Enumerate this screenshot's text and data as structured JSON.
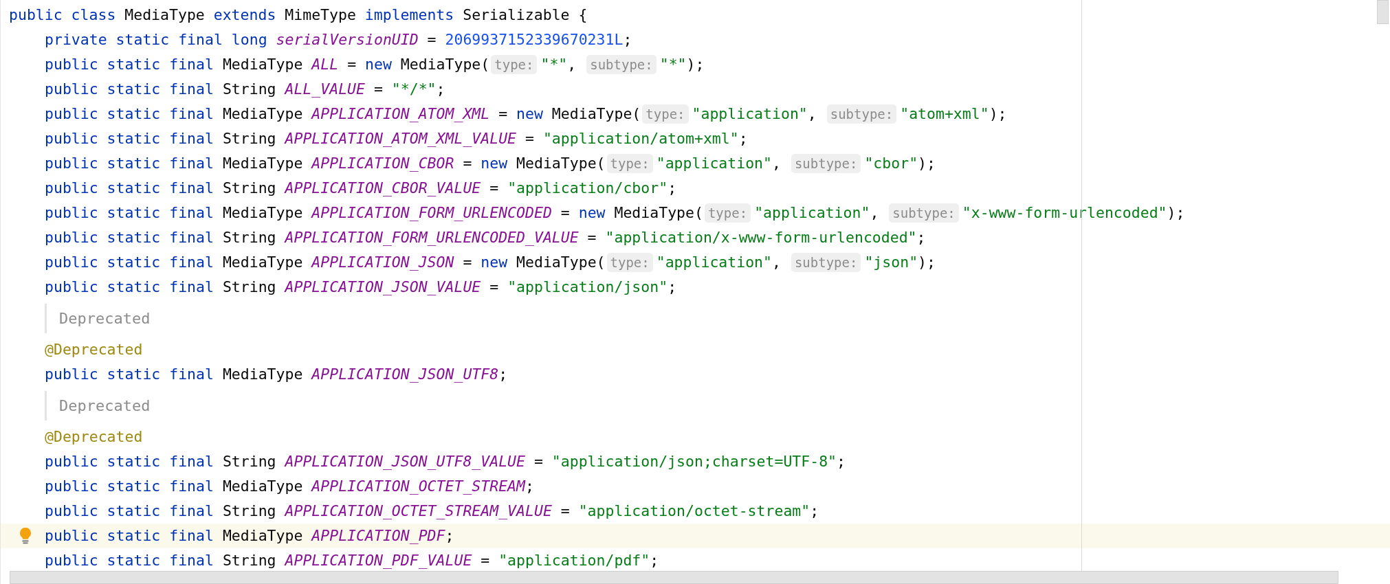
{
  "class_line": {
    "tokens": [
      {
        "kind": "keyword",
        "text": "public class "
      },
      {
        "kind": "plain",
        "text": "MediaType "
      },
      {
        "kind": "keyword",
        "text": "extends "
      },
      {
        "kind": "plain",
        "text": "MimeType "
      },
      {
        "kind": "keyword",
        "text": "implements "
      },
      {
        "kind": "plain",
        "text": "Serializable {"
      }
    ]
  },
  "body": [
    {
      "kind": "code",
      "highlighted": false,
      "tokens": [
        {
          "kind": "keyword",
          "text": "private static final long "
        },
        {
          "kind": "field",
          "text": "serialVersionUID"
        },
        {
          "kind": "plain",
          "text": " = "
        },
        {
          "kind": "number",
          "text": "2069937152339670231L"
        },
        {
          "kind": "plain",
          "text": ";"
        }
      ]
    },
    {
      "kind": "code",
      "highlighted": false,
      "tokens": [
        {
          "kind": "keyword",
          "text": "public static final "
        },
        {
          "kind": "plain",
          "text": "MediaType "
        },
        {
          "kind": "field",
          "text": "ALL"
        },
        {
          "kind": "plain",
          "text": " = "
        },
        {
          "kind": "keyword",
          "text": "new "
        },
        {
          "kind": "plain",
          "text": "MediaType("
        },
        {
          "kind": "hint",
          "text": "type:"
        },
        {
          "kind": "string",
          "text": "\"*\""
        },
        {
          "kind": "plain",
          "text": ", "
        },
        {
          "kind": "hint",
          "text": "subtype:"
        },
        {
          "kind": "string",
          "text": "\"*\""
        },
        {
          "kind": "plain",
          "text": ");"
        }
      ]
    },
    {
      "kind": "code",
      "highlighted": false,
      "tokens": [
        {
          "kind": "keyword",
          "text": "public static final "
        },
        {
          "kind": "plain",
          "text": "String "
        },
        {
          "kind": "field",
          "text": "ALL_VALUE"
        },
        {
          "kind": "plain",
          "text": " = "
        },
        {
          "kind": "string",
          "text": "\"*/*\""
        },
        {
          "kind": "plain",
          "text": ";"
        }
      ]
    },
    {
      "kind": "code",
      "highlighted": false,
      "tokens": [
        {
          "kind": "keyword",
          "text": "public static final "
        },
        {
          "kind": "plain",
          "text": "MediaType "
        },
        {
          "kind": "field",
          "text": "APPLICATION_ATOM_XML"
        },
        {
          "kind": "plain",
          "text": " = "
        },
        {
          "kind": "keyword",
          "text": "new "
        },
        {
          "kind": "plain",
          "text": "MediaType("
        },
        {
          "kind": "hint",
          "text": "type:"
        },
        {
          "kind": "string",
          "text": "\"application\""
        },
        {
          "kind": "plain",
          "text": ", "
        },
        {
          "kind": "hint",
          "text": "subtype:"
        },
        {
          "kind": "string",
          "text": "\"atom+xml\""
        },
        {
          "kind": "plain",
          "text": ");"
        }
      ]
    },
    {
      "kind": "code",
      "highlighted": false,
      "tokens": [
        {
          "kind": "keyword",
          "text": "public static final "
        },
        {
          "kind": "plain",
          "text": "String "
        },
        {
          "kind": "field",
          "text": "APPLICATION_ATOM_XML_VALUE"
        },
        {
          "kind": "plain",
          "text": " = "
        },
        {
          "kind": "string",
          "text": "\"application/atom+xml\""
        },
        {
          "kind": "plain",
          "text": ";"
        }
      ]
    },
    {
      "kind": "code",
      "highlighted": false,
      "tokens": [
        {
          "kind": "keyword",
          "text": "public static final "
        },
        {
          "kind": "plain",
          "text": "MediaType "
        },
        {
          "kind": "field",
          "text": "APPLICATION_CBOR"
        },
        {
          "kind": "plain",
          "text": " = "
        },
        {
          "kind": "keyword",
          "text": "new "
        },
        {
          "kind": "plain",
          "text": "MediaType("
        },
        {
          "kind": "hint",
          "text": "type:"
        },
        {
          "kind": "string",
          "text": "\"application\""
        },
        {
          "kind": "plain",
          "text": ", "
        },
        {
          "kind": "hint",
          "text": "subtype:"
        },
        {
          "kind": "string",
          "text": "\"cbor\""
        },
        {
          "kind": "plain",
          "text": ");"
        }
      ]
    },
    {
      "kind": "code",
      "highlighted": false,
      "tokens": [
        {
          "kind": "keyword",
          "text": "public static final "
        },
        {
          "kind": "plain",
          "text": "String "
        },
        {
          "kind": "field",
          "text": "APPLICATION_CBOR_VALUE"
        },
        {
          "kind": "plain",
          "text": " = "
        },
        {
          "kind": "string",
          "text": "\"application/cbor\""
        },
        {
          "kind": "plain",
          "text": ";"
        }
      ]
    },
    {
      "kind": "code",
      "highlighted": false,
      "tokens": [
        {
          "kind": "keyword",
          "text": "public static final "
        },
        {
          "kind": "plain",
          "text": "MediaType "
        },
        {
          "kind": "field",
          "text": "APPLICATION_FORM_URLENCODED"
        },
        {
          "kind": "plain",
          "text": " = "
        },
        {
          "kind": "keyword",
          "text": "new "
        },
        {
          "kind": "plain",
          "text": "MediaType("
        },
        {
          "kind": "hint",
          "text": "type:"
        },
        {
          "kind": "string",
          "text": "\"application\""
        },
        {
          "kind": "plain",
          "text": ", "
        },
        {
          "kind": "hint",
          "text": "subtype:"
        },
        {
          "kind": "string",
          "text": "\"x-www-form-urlencoded\""
        },
        {
          "kind": "plain",
          "text": ");"
        }
      ]
    },
    {
      "kind": "code",
      "highlighted": false,
      "tokens": [
        {
          "kind": "keyword",
          "text": "public static final "
        },
        {
          "kind": "plain",
          "text": "String "
        },
        {
          "kind": "field",
          "text": "APPLICATION_FORM_URLENCODED_VALUE"
        },
        {
          "kind": "plain",
          "text": " = "
        },
        {
          "kind": "string",
          "text": "\"application/x-www-form-urlencoded\""
        },
        {
          "kind": "plain",
          "text": ";"
        }
      ]
    },
    {
      "kind": "code",
      "highlighted": false,
      "tokens": [
        {
          "kind": "keyword",
          "text": "public static final "
        },
        {
          "kind": "plain",
          "text": "MediaType "
        },
        {
          "kind": "field",
          "text": "APPLICATION_JSON"
        },
        {
          "kind": "plain",
          "text": " = "
        },
        {
          "kind": "keyword",
          "text": "new "
        },
        {
          "kind": "plain",
          "text": "MediaType("
        },
        {
          "kind": "hint",
          "text": "type:"
        },
        {
          "kind": "string",
          "text": "\"application\""
        },
        {
          "kind": "plain",
          "text": ", "
        },
        {
          "kind": "hint",
          "text": "subtype:"
        },
        {
          "kind": "string",
          "text": "\"json\""
        },
        {
          "kind": "plain",
          "text": ");"
        }
      ]
    },
    {
      "kind": "code",
      "highlighted": false,
      "tokens": [
        {
          "kind": "keyword",
          "text": "public static final "
        },
        {
          "kind": "plain",
          "text": "String "
        },
        {
          "kind": "field",
          "text": "APPLICATION_JSON_VALUE"
        },
        {
          "kind": "plain",
          "text": " = "
        },
        {
          "kind": "string",
          "text": "\"application/json\""
        },
        {
          "kind": "plain",
          "text": ";"
        }
      ]
    },
    {
      "kind": "doc",
      "text": "Deprecated"
    },
    {
      "kind": "code",
      "highlighted": false,
      "tokens": [
        {
          "kind": "annotation",
          "text": "@Deprecated"
        }
      ]
    },
    {
      "kind": "code",
      "highlighted": false,
      "tokens": [
        {
          "kind": "keyword",
          "text": "public static final "
        },
        {
          "kind": "plain",
          "text": "MediaType "
        },
        {
          "kind": "field",
          "text": "APPLICATION_JSON_UTF8"
        },
        {
          "kind": "plain",
          "text": ";"
        }
      ]
    },
    {
      "kind": "doc",
      "text": "Deprecated"
    },
    {
      "kind": "code",
      "highlighted": false,
      "tokens": [
        {
          "kind": "annotation",
          "text": "@Deprecated"
        }
      ]
    },
    {
      "kind": "code",
      "highlighted": false,
      "tokens": [
        {
          "kind": "keyword",
          "text": "public static final "
        },
        {
          "kind": "plain",
          "text": "String "
        },
        {
          "kind": "field",
          "text": "APPLICATION_JSON_UTF8_VALUE"
        },
        {
          "kind": "plain",
          "text": " = "
        },
        {
          "kind": "string",
          "text": "\"application/json;charset=UTF-8\""
        },
        {
          "kind": "plain",
          "text": ";"
        }
      ]
    },
    {
      "kind": "code",
      "highlighted": false,
      "tokens": [
        {
          "kind": "keyword",
          "text": "public static final "
        },
        {
          "kind": "plain",
          "text": "MediaType "
        },
        {
          "kind": "field",
          "text": "APPLICATION_OCTET_STREAM"
        },
        {
          "kind": "plain",
          "text": ";"
        }
      ]
    },
    {
      "kind": "code",
      "highlighted": false,
      "tokens": [
        {
          "kind": "keyword",
          "text": "public static final "
        },
        {
          "kind": "plain",
          "text": "String "
        },
        {
          "kind": "field",
          "text": "APPLICATION_OCTET_STREAM_VALUE"
        },
        {
          "kind": "plain",
          "text": " = "
        },
        {
          "kind": "string",
          "text": "\"application/octet-stream\""
        },
        {
          "kind": "plain",
          "text": ";"
        }
      ]
    },
    {
      "kind": "code",
      "highlighted": true,
      "tokens": [
        {
          "kind": "keyword",
          "text": "public static final "
        },
        {
          "kind": "plain",
          "text": "MediaType "
        },
        {
          "kind": "field",
          "text": "APPLICATION_PDF"
        },
        {
          "kind": "plain",
          "text": ";"
        }
      ]
    },
    {
      "kind": "code",
      "highlighted": false,
      "tokens": [
        {
          "kind": "keyword",
          "text": "public static final "
        },
        {
          "kind": "plain",
          "text": "String "
        },
        {
          "kind": "field",
          "text": "APPLICATION_PDF_VALUE"
        },
        {
          "kind": "plain",
          "text": " = "
        },
        {
          "kind": "string",
          "text": "\"application/pdf\""
        },
        {
          "kind": "plain",
          "text": ";"
        }
      ]
    }
  ]
}
